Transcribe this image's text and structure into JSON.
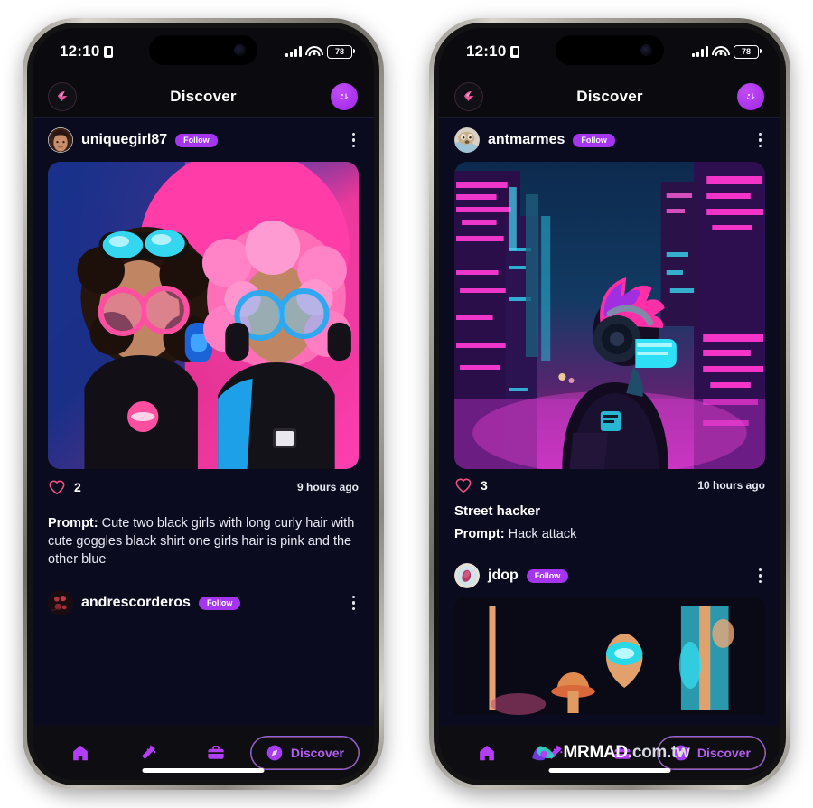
{
  "status_bar": {
    "time": "12:10",
    "battery_percent": "78",
    "location_icon": "location-icon",
    "cellular_icon": "cellular-bars-icon",
    "wifi_icon": "wifi-icon",
    "battery_icon": "battery-icon"
  },
  "app_header": {
    "title": "Discover",
    "logo_icon": "app-logo-icon",
    "profile_icon": "profile-avatar-icon"
  },
  "colors": {
    "accent_purple": "#a635f0",
    "accent_violet": "#b45cf0",
    "like_pink": "#ef4f7e",
    "app_bg": "#0b0b20",
    "bar_bg": "#0b0b0f"
  },
  "tabbar": {
    "items": [
      {
        "name": "home",
        "icon": "home-icon",
        "label": ""
      },
      {
        "name": "create",
        "icon": "magic-wand-icon",
        "label": ""
      },
      {
        "name": "gallery",
        "icon": "briefcase-icon",
        "label": ""
      },
      {
        "name": "discover",
        "icon": "compass-icon",
        "label": "Discover"
      }
    ]
  },
  "watermark": {
    "text_main": "MRMAD",
    "text_suffix": ".com.tw",
    "logo_icon": "mrmad-logo-icon"
  },
  "phones": [
    {
      "id": "phone-left",
      "posts": [
        {
          "username": "uniquegirl87",
          "follow_label": "Follow",
          "menu_icon": "kebab-menu-icon",
          "like_icon": "heart-icon",
          "like_count": "2",
          "timestamp": "9 hours ago",
          "title": "",
          "prompt_label": "Prompt:",
          "prompt_text": "Cute two black girls with long curly hair with cute goggles black shirt one girls hair is pink and the other blue",
          "image_alt": "two-anime-girls-with-goggles-artwork"
        },
        {
          "username": "andrescorderos",
          "follow_label": "Follow",
          "menu_icon": "kebab-menu-icon",
          "like_icon": "heart-icon",
          "like_count": "",
          "timestamp": "",
          "title": "",
          "prompt_label": "",
          "prompt_text": "",
          "image_alt": ""
        }
      ]
    },
    {
      "id": "phone-right",
      "posts": [
        {
          "username": "antmarmes",
          "follow_label": "Follow",
          "menu_icon": "kebab-menu-icon",
          "like_icon": "heart-icon",
          "like_count": "3",
          "timestamp": "10 hours ago",
          "title": "Street hacker",
          "prompt_label": "Prompt:",
          "prompt_text": "Hack attack",
          "image_alt": "cyberpunk-street-hacker-artwork"
        },
        {
          "username": "jdop",
          "follow_label": "Follow",
          "menu_icon": "kebab-menu-icon",
          "like_icon": "heart-icon",
          "like_count": "",
          "timestamp": "",
          "title": "",
          "prompt_label": "",
          "prompt_text": "",
          "image_alt": "dark-neon-scene-artwork"
        }
      ]
    }
  ]
}
